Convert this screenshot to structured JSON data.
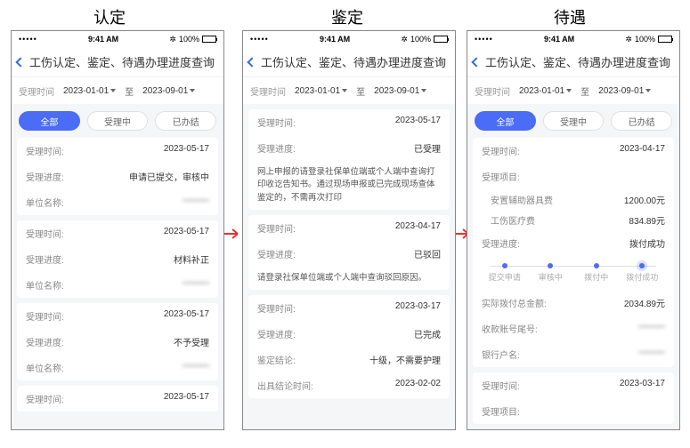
{
  "status": {
    "time": "9:41 AM",
    "battery": "100%"
  },
  "header": {
    "title": "工伤认定、鉴定、待遇办理进度查询"
  },
  "dateFilter": {
    "label": "受理时间",
    "from": "2023-01-01",
    "sep": "至",
    "to": "2023-09-01"
  },
  "tabs": {
    "all": "全部",
    "processing": "受理中",
    "done": "已办结"
  },
  "labels": {
    "outside1": "认定",
    "outside2": "鉴定",
    "outside3": "待遇",
    "acceptTime": "受理时间:",
    "acceptProgress": "受理进度:",
    "unitName": "单位名称:",
    "appraisalResult": "鉴定结论:",
    "resultTime": "出具结论时间:",
    "acceptItem": "受理项目:",
    "item1": "安置辅助器具费",
    "item2": "工伤医疗费",
    "totalPaid": "实际拨付总金额:",
    "acctTail": "收款账号尾号:",
    "bankName": "银行户名:",
    "tl1": "提交申请",
    "tl2": "审核中",
    "tl3": "拨付中",
    "tl4": "拨付成功"
  },
  "screen1": {
    "cards": [
      {
        "time": "2023-05-17",
        "progress": "申请已提交，审核中",
        "unit": "———"
      },
      {
        "time": "2023-05-17",
        "progress": "材料补正",
        "unit": "———"
      },
      {
        "time": "2023-05-17",
        "progress": "不予受理",
        "unit": "———"
      },
      {
        "time": "2023-05-17"
      }
    ]
  },
  "screen2": {
    "cards": [
      {
        "time": "2023-05-17",
        "progress": "已受理",
        "note": "网上申报的请登录社保单位端或个人端中查询打印收讫告知书。通过现场申报或已完成现场查体鉴定的，不需再次打印"
      },
      {
        "time": "2023-04-17",
        "progress": "已驳回",
        "note": "请登录社保单位端或个人端中查询驳回原因。"
      },
      {
        "time": "2023-03-17",
        "progress": "已完成",
        "result": "十级，不需要护理",
        "resultTime": "2023-02-02"
      }
    ]
  },
  "screen3": {
    "cards": [
      {
        "time": "2023-04-17",
        "item1v": "1200.00元",
        "item2v": "834.89元",
        "progress": "拨付成功",
        "total": "2034.89元",
        "tail": "———",
        "bank": "———"
      },
      {
        "time": "2023-03-17"
      }
    ]
  }
}
